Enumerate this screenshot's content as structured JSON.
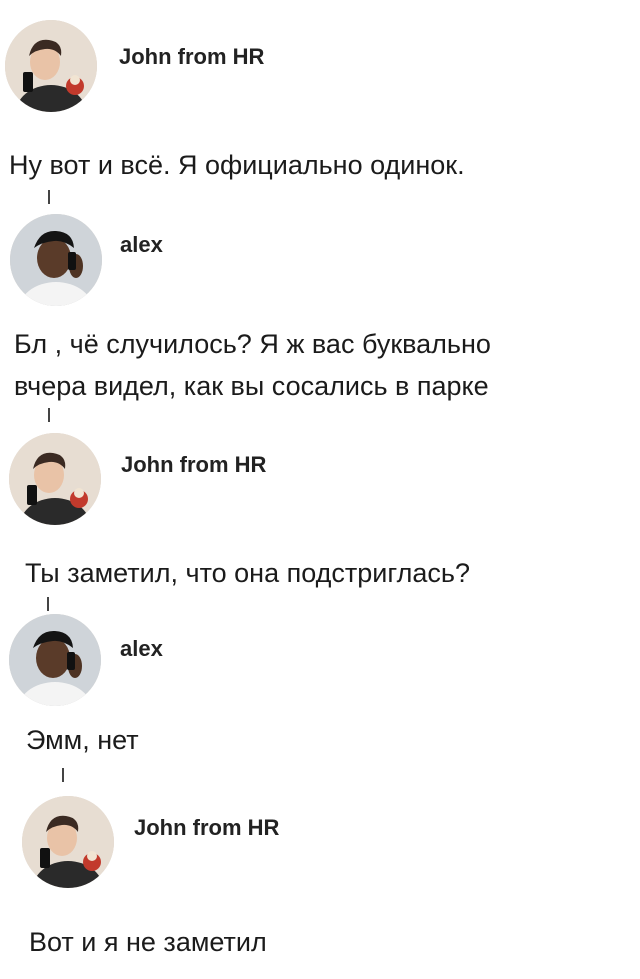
{
  "thread": [
    {
      "user": "John from HR",
      "avatar": "john-avatar",
      "lines": [
        "Ну вот и всё. Я официально одинок."
      ]
    },
    {
      "user": "alex",
      "avatar": "alex-avatar",
      "lines": [
        "Бл   , чё случилось? Я ж вас буквально",
        "вчера видел, как вы сосались в парке"
      ]
    },
    {
      "user": "John from HR",
      "avatar": "john-avatar",
      "lines": [
        "Ты заметил, что она подстриглась?"
      ]
    },
    {
      "user": "alex",
      "avatar": "alex-avatar",
      "lines": [
        "Эмм, нет"
      ]
    },
    {
      "user": "John from HR",
      "avatar": "john-avatar",
      "lines": [
        "Вот и я не заметил"
      ]
    }
  ]
}
